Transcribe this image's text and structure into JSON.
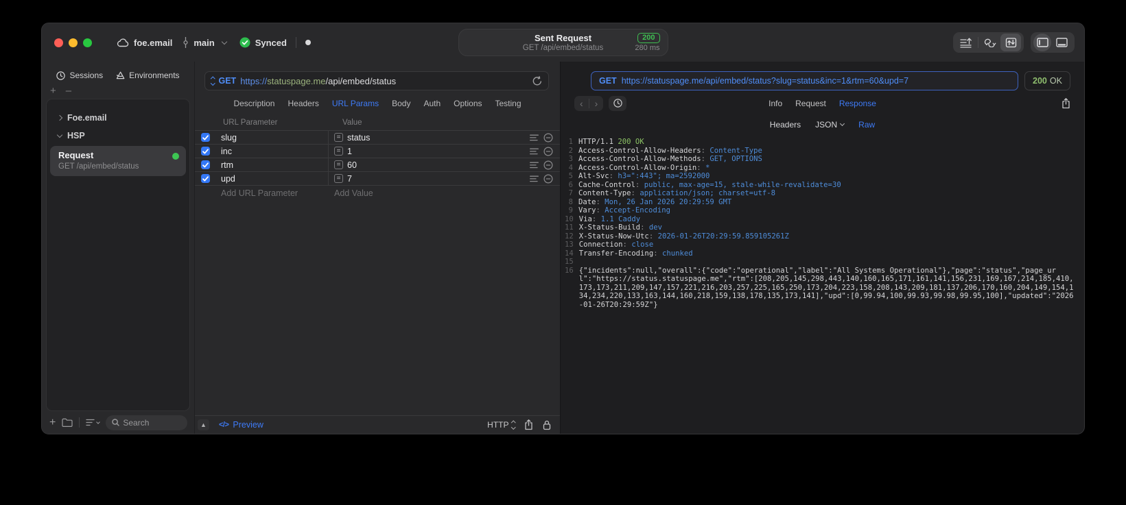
{
  "titlebar": {
    "project": "foe.email",
    "branch": "main",
    "sync_status": "Synced",
    "pill": {
      "title": "Sent Request",
      "subtitle": "GET /api/embed/status",
      "status_code": "200",
      "duration": "280 ms"
    }
  },
  "sidebar": {
    "tabs": [
      {
        "label": "Sessions"
      },
      {
        "label": "Environments"
      }
    ],
    "tree": [
      {
        "label": "Foe.email"
      },
      {
        "label": "HSP"
      }
    ],
    "request_item": {
      "title": "Request",
      "subtitle": "GET /api/embed/status"
    },
    "search_placeholder": "Search"
  },
  "request": {
    "method": "GET",
    "url_scheme": "https://",
    "url_host": "statuspage.me",
    "url_path": "/api/embed/status",
    "tabs": [
      "Description",
      "Headers",
      "URL Params",
      "Body",
      "Auth",
      "Options",
      "Testing"
    ],
    "active_tab": "URL Params",
    "params": {
      "col_name": "URL Parameter",
      "col_value": "Value",
      "rows": [
        {
          "name": "slug",
          "value": "status",
          "enabled": true
        },
        {
          "name": "inc",
          "value": "1",
          "enabled": true
        },
        {
          "name": "rtm",
          "value": "60",
          "enabled": true
        },
        {
          "name": "upd",
          "value": "7",
          "enabled": true
        }
      ],
      "add_name_placeholder": "Add URL Parameter",
      "add_value_placeholder": "Add Value"
    },
    "footer": {
      "preview_icon": "</>",
      "preview_label": "Preview",
      "protocol": "HTTP"
    }
  },
  "response": {
    "method": "GET",
    "url": "https://statuspage.me/api/embed/status?slug=status&inc=1&rtm=60&upd=7",
    "status": "200",
    "status_text": "OK",
    "tabs": [
      "Info",
      "Request",
      "Response"
    ],
    "active_tab": "Response",
    "subtabs": [
      {
        "label": "Headers"
      },
      {
        "label": "JSON",
        "dropdown": true
      },
      {
        "label": "Raw"
      }
    ],
    "active_subtab": "Raw",
    "code": {
      "status_line": {
        "protocol": "HTTP/1.1",
        "status": "200 OK"
      },
      "headers": [
        {
          "name": "Access-Control-Allow-Headers",
          "value": "Content-Type"
        },
        {
          "name": "Access-Control-Allow-Methods",
          "value": "GET, OPTIONS"
        },
        {
          "name": "Access-Control-Allow-Origin",
          "value": "*"
        },
        {
          "name": "Alt-Svc",
          "value": "h3=\":443\"; ma=2592000"
        },
        {
          "name": "Cache-Control",
          "value": "public, max-age=15, stale-while-revalidate=30"
        },
        {
          "name": "Content-Type",
          "value": "application/json; charset=utf-8"
        },
        {
          "name": "Date",
          "value": "Mon, 26 Jan 2026 20:29:59 GMT"
        },
        {
          "name": "Vary",
          "value": "Accept-Encoding"
        },
        {
          "name": "Via",
          "value": "1.1 Caddy"
        },
        {
          "name": "X-Status-Build",
          "value": "dev"
        },
        {
          "name": "X-Status-Now-Utc",
          "value": "2026-01-26T20:29:59.859105261Z"
        },
        {
          "name": "Connection",
          "value": "close"
        },
        {
          "name": "Transfer-Encoding",
          "value": "chunked"
        }
      ],
      "body": "{\"incidents\":null,\"overall\":{\"code\":\"operational\",\"label\":\"All Systems Operational\"},\"page\":\"status\",\"page_url\":\"https://status.statuspage.me\",\"rtm\":[208,205,145,298,443,140,160,165,171,161,141,156,231,169,167,214,185,410,173,173,211,209,147,157,221,216,203,257,225,165,250,173,204,223,158,208,143,209,181,137,206,170,160,204,149,154,134,234,220,133,163,144,160,218,159,138,178,135,173,141],\"upd\":[0,99.94,100,99.93,99.98,99.95,100],\"updated\":\"2026-01-26T20:29:59Z\"}"
    }
  },
  "colors": {
    "accent_blue": "#3e7bf7",
    "code_value_blue": "#4e8cd8",
    "status_green": "#8cc265",
    "badge_green": "#3fbf52",
    "checkbox_blue": "#3478f6"
  }
}
